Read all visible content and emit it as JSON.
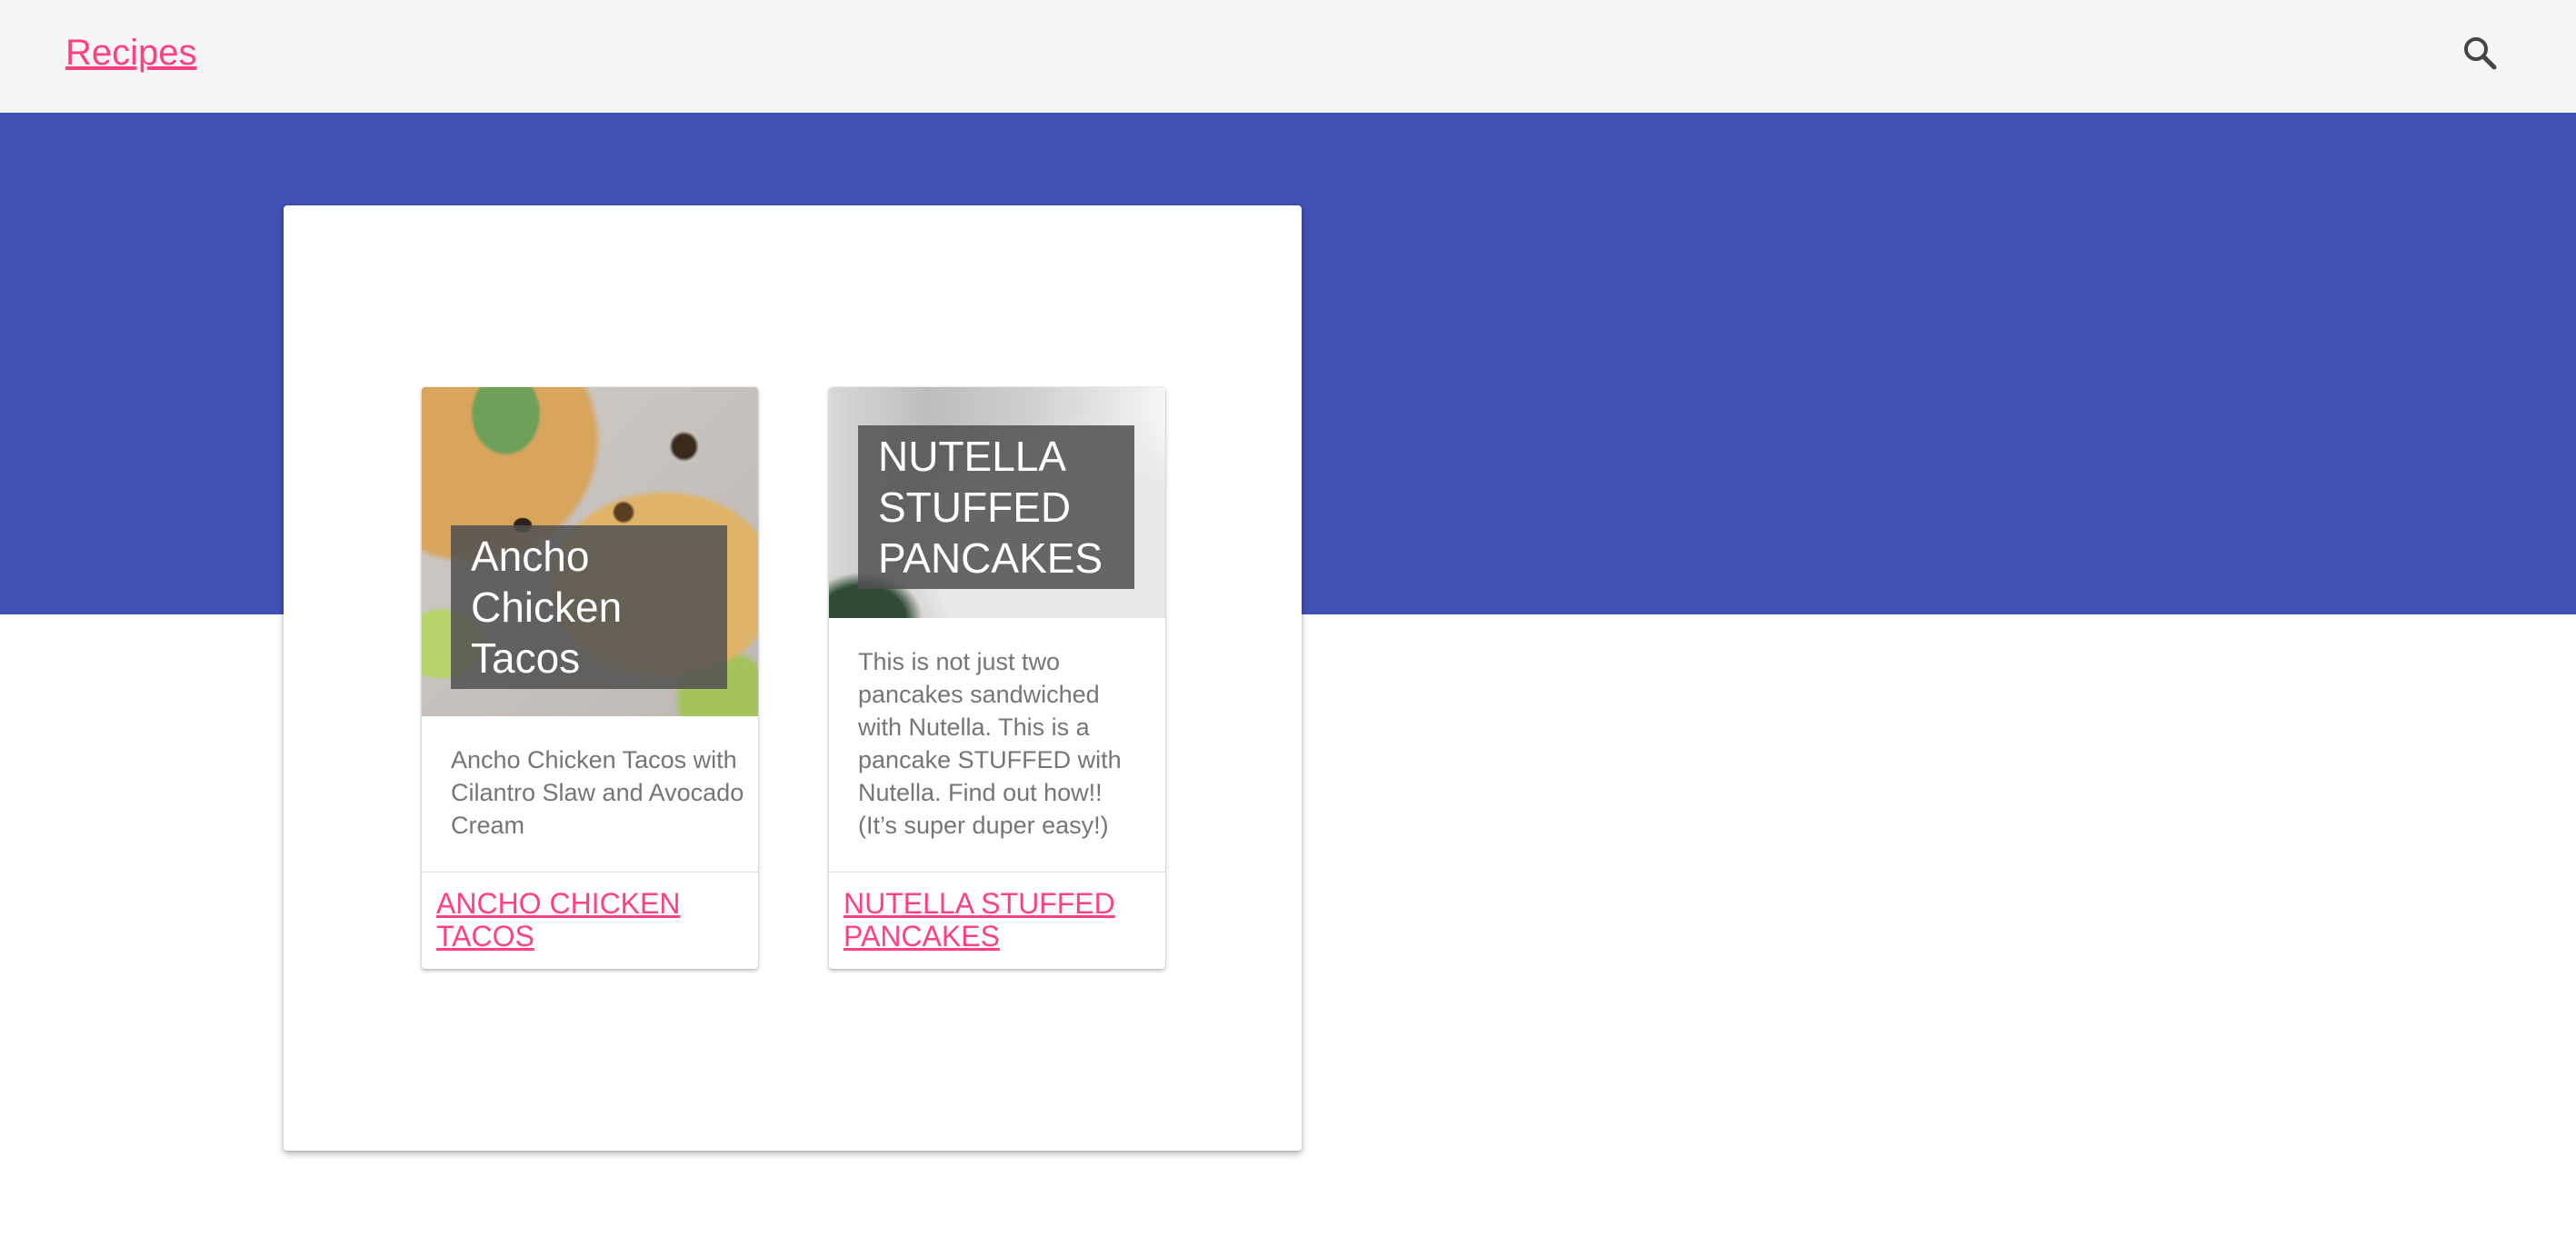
{
  "app": {
    "title": "Recipes"
  },
  "header": {
    "search_icon": "search-icon"
  },
  "colors": {
    "accent": "#ff4081",
    "primary": "#3f51b5",
    "toolbar": "#f5f5f5"
  },
  "cards": [
    {
      "image_title": "Ancho Chicken Tacos",
      "description": "Ancho Chicken Tacos with Cilantro Slaw and Avocado Cream",
      "link": "ANCHO CHICKEN TACOS"
    },
    {
      "image_title": "NUTELLA STUFFED PANCAKES",
      "description": "This is not just two pancakes sandwiched with Nutella. This is a pancake STUFFED with Nutella. Find out how!! (It’s super duper easy!)",
      "link": "NUTELLA STUFFED PANCAKES"
    }
  ]
}
